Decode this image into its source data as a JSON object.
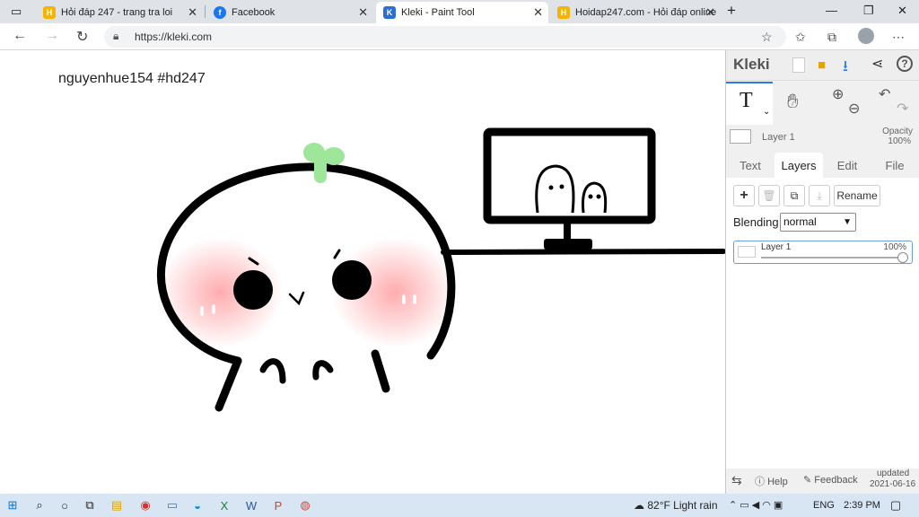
{
  "browser": {
    "tabs": [
      {
        "title": "Hỏi đáp 247 - trang tra loi",
        "favicon_color": "#f4b400"
      },
      {
        "title": "Facebook",
        "favicon_color": "#1877f2"
      },
      {
        "title": "Kleki - Paint Tool",
        "favicon_color": "#2b6fd6"
      },
      {
        "title": "Hoidap247.com - Hỏi đáp online",
        "favicon_color": "#f4b400"
      }
    ],
    "favicon_letters": [
      "H",
      "f",
      "K",
      "H"
    ],
    "address": "https://kleki.com"
  },
  "canvas": {
    "signature": "nguyenhue154  #hd247"
  },
  "panel": {
    "logo": "Kleki",
    "layer_name": "Layer 1",
    "opacity_label": "Opacity",
    "opacity_value": "100%",
    "tabs": [
      "Text",
      "Layers",
      "Edit",
      "File"
    ],
    "active_tab": "Layers",
    "rename_label": "Rename",
    "blending_label": "Blending",
    "blending_value": "normal",
    "layer_item_name": "Layer 1",
    "layer_item_opacity": "100%",
    "opacity_fraction": 1.0,
    "help_label": "Help",
    "feedback_label": "Feedback",
    "updated_label": "updated",
    "updated_date": "2021-06-16"
  },
  "taskbar": {
    "weather": "82°F  Light rain",
    "lang": "ENG",
    "time": "2:39 PM"
  },
  "colors": {
    "accent": "#2a7ae2",
    "sprout": "#9de69a",
    "blush": "#ff9da0"
  }
}
